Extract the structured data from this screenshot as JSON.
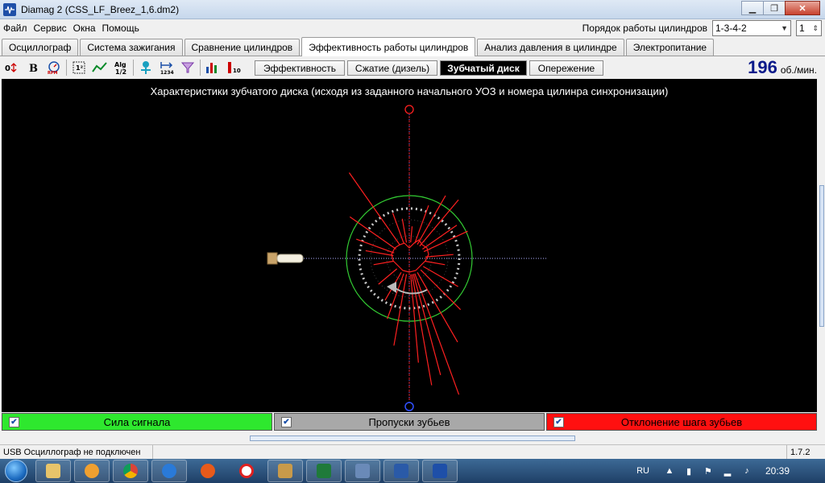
{
  "window": {
    "title": "Diamag 2 (CSS_LF_Breez_1,6.dm2)"
  },
  "menu": {
    "items": [
      "Файл",
      "Сервис",
      "Окна",
      "Помощь"
    ],
    "cylinder_order_label": "Порядок работы цилиндров",
    "cylinder_order_value": "1-3-4-2",
    "cylinder_number_value": "1"
  },
  "tabs": [
    {
      "label": "Осциллограф"
    },
    {
      "label": "Система зажигания"
    },
    {
      "label": "Сравнение цилиндров"
    },
    {
      "label": "Эффективность работы цилиндров",
      "active": true
    },
    {
      "label": "Анализ давления в цилиндре"
    },
    {
      "label": "Электропитание"
    }
  ],
  "toolbar": {
    "icons": [
      "arrows-icon",
      "bold-icon",
      "rpm-gauge-icon",
      "scale-icon",
      "graph-icon",
      "algorithm-icon",
      "tree-icon",
      "numbering-icon",
      "filter-icon",
      "chart-bars-icon",
      "color-scale-icon"
    ],
    "subtabs": [
      {
        "label": "Эффективность"
      },
      {
        "label": "Сжатие (дизель)"
      },
      {
        "label": "Зубчатый диск",
        "active": true
      },
      {
        "label": "Опережение"
      }
    ],
    "rpm_value": "196",
    "rpm_unit": "об./мин."
  },
  "canvas": {
    "title": "Характеристики зубчатого диска (исходя из заданного начального УОЗ и номера цилинра синхронизации)",
    "colors": {
      "background": "#000000",
      "ring": "#33cc33",
      "signal": "#ff2020",
      "axis": "#7070ff",
      "teeth": "#c8c8c8"
    }
  },
  "legend": [
    {
      "label": "Сила сигнала",
      "color": "#2ee82e",
      "checked": true
    },
    {
      "label": "Пропуски зубьев",
      "color": "#a8a8a8",
      "checked": true
    },
    {
      "label": "Отклонение шага зубьев",
      "color": "#ff1010",
      "checked": true
    }
  ],
  "status": {
    "connection": "USB Осциллограф не подключен",
    "version": "1.7.2"
  },
  "taskbar": {
    "language": "RU",
    "time": "20:39"
  }
}
